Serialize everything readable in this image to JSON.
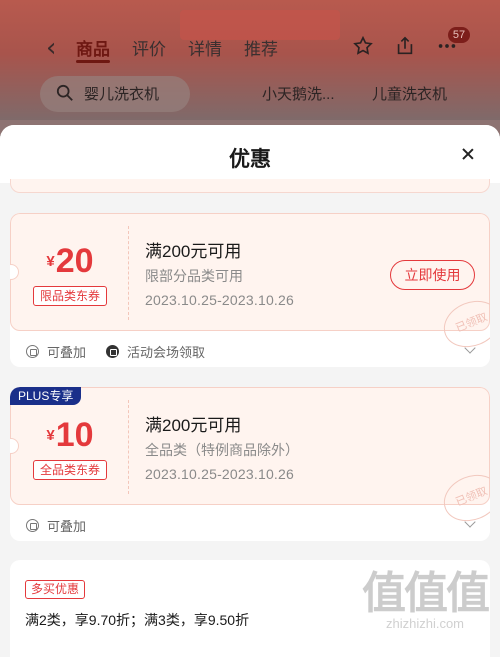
{
  "background": {
    "nav_tabs": [
      "商品",
      "评价",
      "详情",
      "推荐"
    ],
    "active_tab": "商品",
    "cart_count": "57",
    "search_chips": [
      "婴儿洗衣机",
      "小天鹅洗...",
      "儿童洗衣机"
    ]
  },
  "sheet": {
    "title": "优惠"
  },
  "coupons": [
    {
      "currency": "¥",
      "amount": "20",
      "type_tag": "限品类东券",
      "condition": "满200元可用",
      "scope": "限部分品类可用",
      "validity": "2023.10.25-2023.10.26",
      "action": "立即使用",
      "stamp": "已领取",
      "footer": [
        "可叠加",
        "活动会场领取"
      ]
    },
    {
      "badge": "PLUS专享",
      "currency": "¥",
      "amount": "10",
      "type_tag": "全品类东券",
      "condition": "满200元可用",
      "scope": "全品类（特例商品除外）",
      "validity": "2023.10.25-2023.10.26",
      "stamp": "已领取",
      "footer": [
        "可叠加"
      ]
    }
  ],
  "multi_buy": {
    "tag": "多买优惠",
    "text": "满2类，享9.70折；满3类，享9.50折"
  },
  "watermark": {
    "logo": "值值值",
    "site": "zhizhizhi.com"
  },
  "colors": {
    "accent": "#e4393c",
    "plus": "#1a2f8a",
    "coupon_bg": "#fff4ef"
  }
}
